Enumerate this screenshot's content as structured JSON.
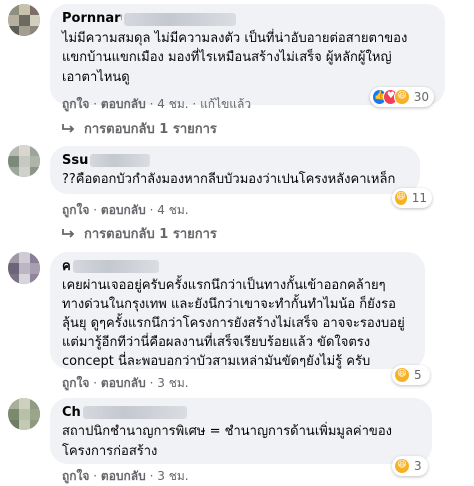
{
  "comments": [
    {
      "author": "Pornnaruss Sukkaburg",
      "text": "ไม่มีความสมดุล ไม่มีความลงตัว เป็นที่น่าอับอายต่อสายตาของ\nแขกบ้านแขกเมือง มองที่ไรเหมือนสร้างไม่เสร็จ ผู้หลักผู้ใหญ่\nเอาตาไหนดู",
      "reaction_count": "30",
      "reactions": [
        "like-icon",
        "love-icon",
        "haha-icon"
      ],
      "like_label": "ถูกใจ",
      "reply_label": "ตอบกลับ",
      "time": "4 ชม.",
      "edited": "แก้ไขแล้ว",
      "replies_label": "การตอบกลับ 1 รายการ"
    },
    {
      "author": "Ssu",
      "text": "??คือดอกบัวกำลังมองหากลีบบัวมองว่าเปนโครงหลังคาเหล็ก",
      "reaction_count": "11",
      "reactions": [
        "haha-icon"
      ],
      "like_label": "ถูกใจ",
      "reply_label": "ตอบกลับ",
      "time": "4 ชม.",
      "replies_label": "การตอบกลับ 1 รายการ"
    },
    {
      "author": "ค",
      "text": "เคยผ่านเจออยู่ครับครั้งแรกนึกว่าเป็นทางกั้นเข้าออกคล้ายๆ\nทางด่วนในกรุงเทพ และยังนึกว่าเขาจะทำกั้นทำไมน้อ ก็ยังรอ\nลุ้นยุ ดูๆครั้งแรกนึกว่าโครงการยังสร้างไม่เสร็จ อาจจะรองบอยู่\nแต่มารู้อีกทีว่านี่คือผลงานที่เสร็จเรียบร้อยแล้ว ขัดใจตรง\nconcept นี่ละพอบอกว่าบัวสามเหล่ามันขัดๆยังไม่รู้ ครับ",
      "reaction_count": "5",
      "reactions": [
        "haha-icon"
      ],
      "like_label": "ถูกใจ",
      "reply_label": "ตอบกลับ",
      "time": "3 ชม."
    },
    {
      "author": "Ch",
      "text": "สถาปนิกชำนาญการพิเศษ = ชำนาญการด้านเพิ่มมูลค่าของ\nโครงการก่อสร้าง",
      "reaction_count": "3",
      "reactions": [
        "haha-icon"
      ],
      "like_label": "ถูกใจ",
      "reply_label": "ตอบกลับ",
      "time": "3 ชม."
    }
  ],
  "separator": "·",
  "colors": {
    "bubble": "#f0f2f5",
    "meta": "#65676b",
    "like": "#1877f2",
    "love": "#f33e58",
    "haha": "#f7b125"
  }
}
